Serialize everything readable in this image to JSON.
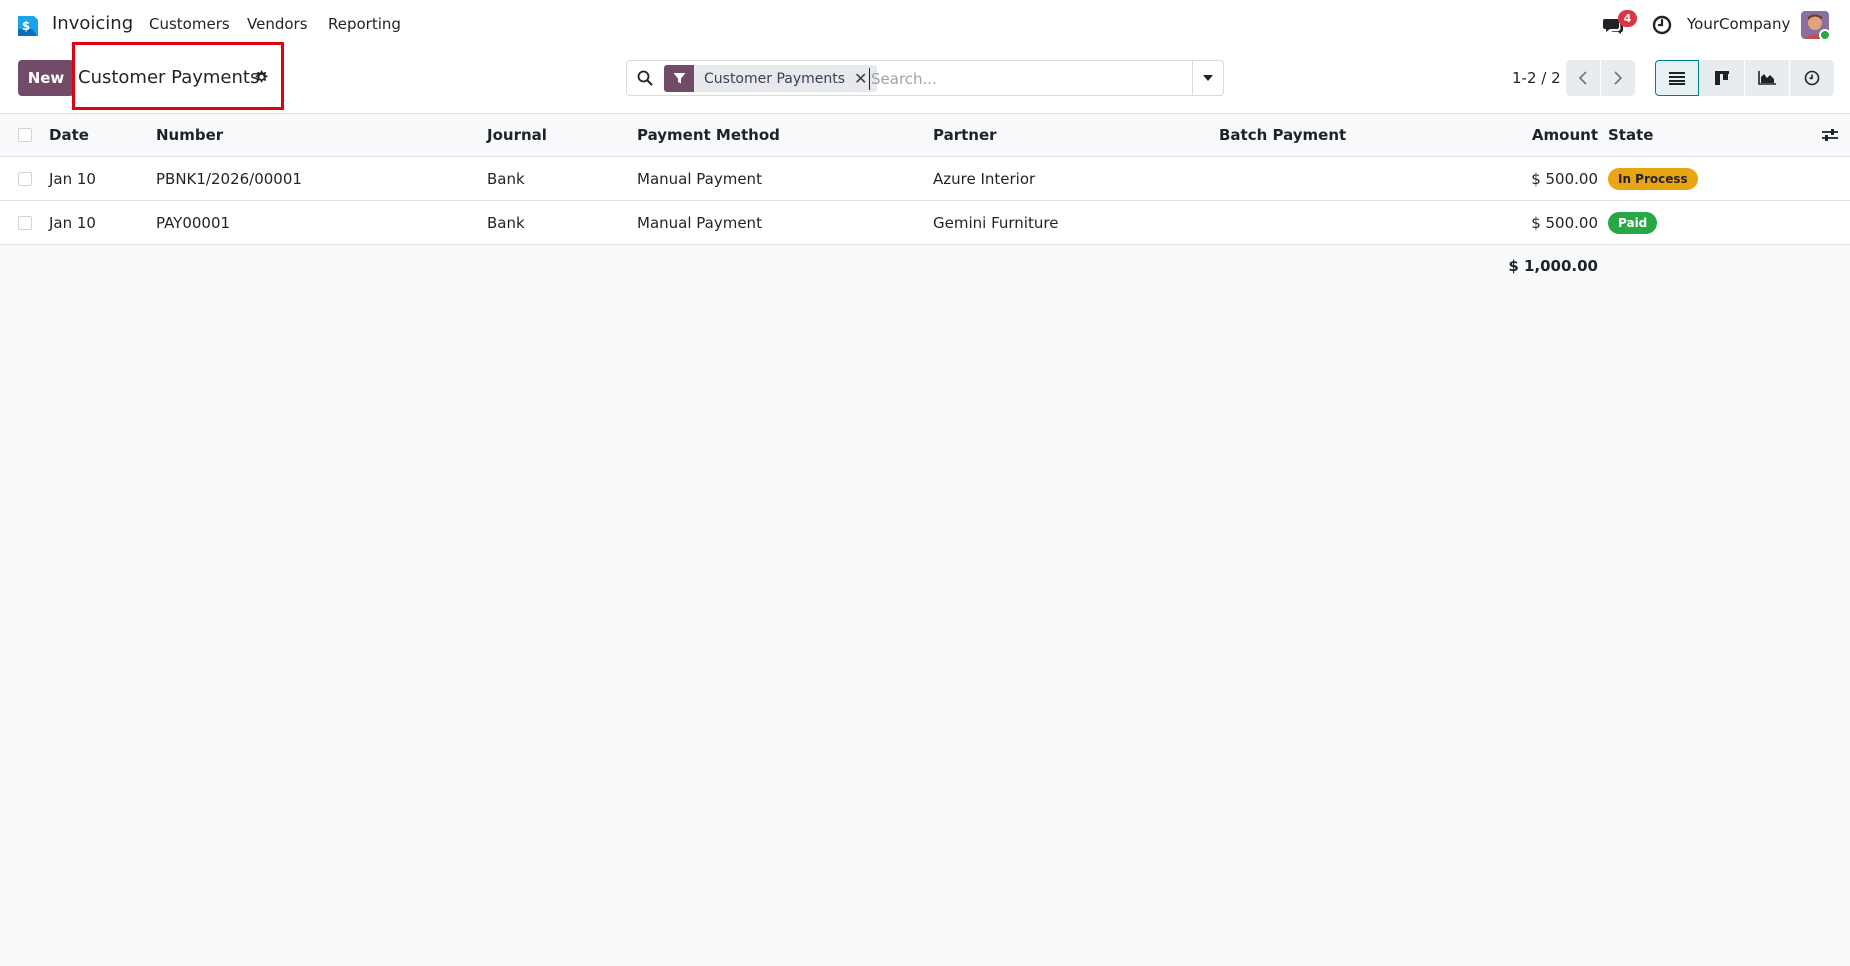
{
  "navbar": {
    "app_name": "Invoicing",
    "menu": [
      "Customers",
      "Vendors",
      "Reporting"
    ],
    "chat_count": "4",
    "company": "YourCompany"
  },
  "control": {
    "new_label": "New",
    "title": "Customer Payments",
    "search": {
      "facet": "Customer Payments",
      "remove_symbol": "✕",
      "placeholder": "Search..."
    },
    "pager": "1-2 / 2"
  },
  "table": {
    "headers": {
      "date": "Date",
      "number": "Number",
      "journal": "Journal",
      "payment_method": "Payment Method",
      "partner": "Partner",
      "batch_payment": "Batch Payment",
      "amount": "Amount",
      "state": "State"
    },
    "rows": [
      {
        "date": "Jan 10",
        "number": "PBNK1/2026/00001",
        "journal": "Bank",
        "payment_method": "Manual Payment",
        "partner": "Azure Interior",
        "batch_payment": "",
        "amount": "$ 500.00",
        "state": "In Process"
      },
      {
        "date": "Jan 10",
        "number": "PAY00001",
        "journal": "Bank",
        "payment_method": "Manual Payment",
        "partner": "Gemini Furniture",
        "batch_payment": "",
        "amount": "$ 500.00",
        "state": "Paid"
      }
    ],
    "total": "$ 1,000.00"
  },
  "colors": {
    "brand": "#714b67",
    "accent": "#017e84",
    "in_process": "#e9a513",
    "paid": "#28a745",
    "highlight": "#e3000f"
  }
}
